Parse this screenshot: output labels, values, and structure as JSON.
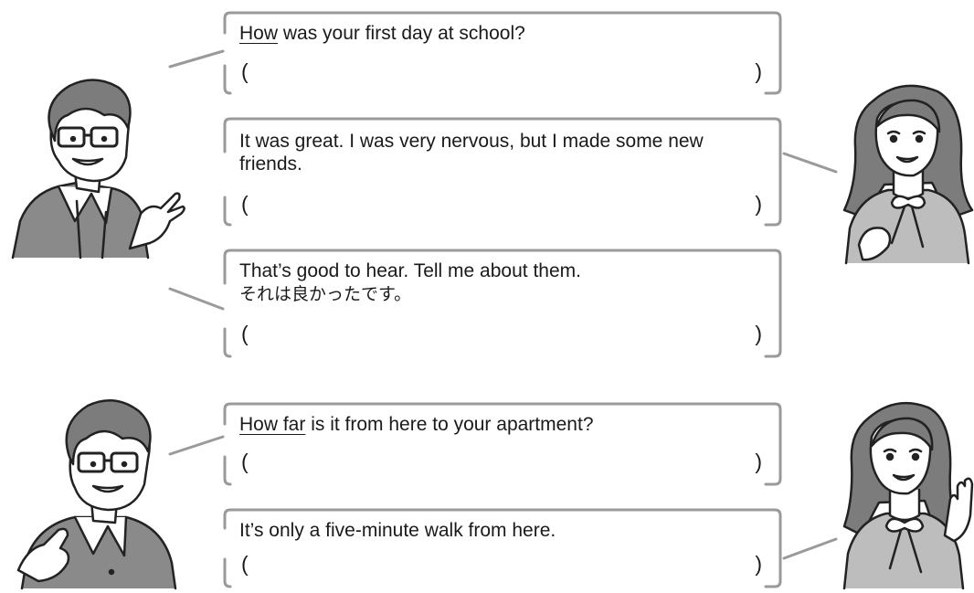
{
  "dialogue1": {
    "line1": {
      "underlined": "How",
      "rest": " was your first day at school?",
      "open": "(",
      "close": ")"
    },
    "line2": {
      "text": "It was great. I was very nervous, but I made some new friends.",
      "open": "(",
      "close": ")"
    },
    "line3": {
      "text": "That’s good to hear. Tell me about them.",
      "note": "それは良かったです。",
      "open": "(",
      "close": ")"
    }
  },
  "dialogue2": {
    "line1": {
      "underlined": "How far",
      "rest": " is it from here to your apartment?",
      "open": "(",
      "close": ")"
    },
    "line2": {
      "text": "It’s only a five-minute walk from here.",
      "open": "(",
      "close": ")"
    }
  },
  "colors": {
    "frame": "#9a9a9a",
    "hair": "#7c7c7c",
    "line": "#222222"
  }
}
